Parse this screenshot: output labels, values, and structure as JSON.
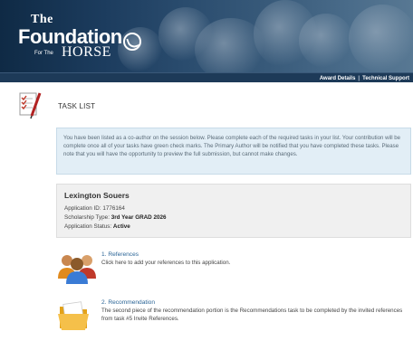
{
  "header": {
    "logo_the": "The",
    "logo_foundation": "Foundation",
    "logo_for_the": "For The",
    "logo_horse": "HORSE",
    "nav": [
      "Award Details",
      "Technical Support"
    ]
  },
  "page": {
    "title": "TASK LIST"
  },
  "info": {
    "text": "You have been listed as a co-author on the session below. Please complete each of the required tasks in your list. Your contribution will be complete once all of your tasks have green check marks. The Primary Author will be notified that you have completed these tasks. Please note that you will have the opportunity to preview the full submission, but cannot make changes."
  },
  "applicant": {
    "name": "Lexington Souers",
    "application_id_label": "Application ID:",
    "application_id": "1776164",
    "scholarship_type_label": "Scholarship Type:",
    "scholarship_type": "3rd Year GRAD 2026",
    "status_label": "Application Status:",
    "status": "Active"
  },
  "tasks": [
    {
      "title": "1. References",
      "description": "Click here to add your references to this application.",
      "icon": "people-icon"
    },
    {
      "title": "2. Recommendation",
      "description": "The second piece of the recommendation portion is the Recommendations task to be completed by the invited references from task #5 Invite References.",
      "icon": "folder-icon"
    }
  ],
  "colors": {
    "banner": "#1c3c5e",
    "navbar": "#1d3a58",
    "info_bg": "#e2eef6",
    "summary_bg": "#f0f0f0",
    "link": "#2a6496"
  }
}
